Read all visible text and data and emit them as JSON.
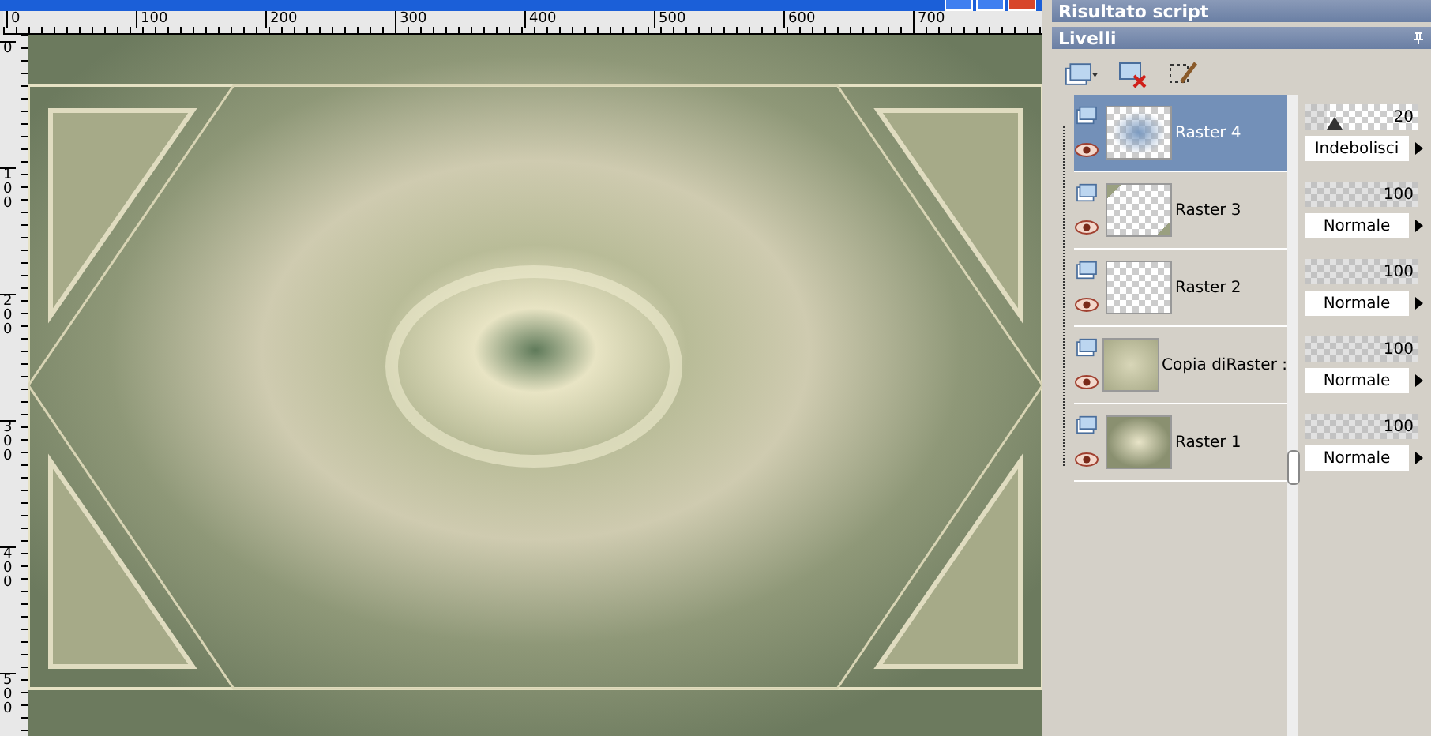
{
  "ruler_top": {
    "labels": [
      "0",
      "100",
      "200",
      "300",
      "400",
      "500",
      "600",
      "700"
    ]
  },
  "ruler_left": {
    "labels": [
      "0",
      "100",
      "200",
      "300",
      "400",
      "500"
    ]
  },
  "script_panel": {
    "title": "Risultato script"
  },
  "layers_panel": {
    "title": "Livelli",
    "layers": [
      {
        "name": "Raster 4",
        "selected": true,
        "opacity": "20",
        "level": 0.2,
        "blend": "Indebolisci"
      },
      {
        "name": "Raster 3",
        "selected": false,
        "opacity": "100",
        "level": 1,
        "blend": "Normale"
      },
      {
        "name": "Raster 2",
        "selected": false,
        "opacity": "100",
        "level": 1,
        "blend": "Normale"
      },
      {
        "name": "Copia diRaster :",
        "selected": false,
        "opacity": "100",
        "level": 1,
        "blend": "Normale"
      },
      {
        "name": "Raster 1",
        "selected": false,
        "opacity": "100",
        "level": 1,
        "blend": "Normale"
      }
    ]
  }
}
